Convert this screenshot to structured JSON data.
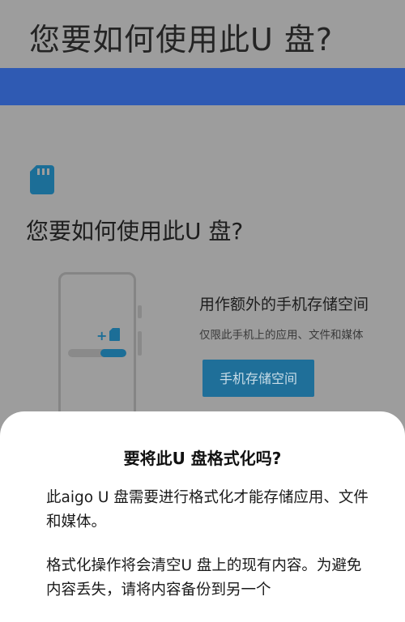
{
  "header": {
    "title": "您要如何使用此U 盘?"
  },
  "content": {
    "icon": "sd-card-icon",
    "subtitle": "您要如何使用此U 盘?",
    "option": {
      "title": "用作额外的手机存储空间",
      "description": "仅限此手机上的应用、文件和媒体",
      "button_label": "手机存储空间",
      "illustration_plus": "+",
      "illustration_fill": 0.45
    }
  },
  "dialog": {
    "title": "要将此U 盘格式化吗?",
    "paragraph1": "此aigo U 盘需要进行格式化才能存储应用、文件和媒体。",
    "paragraph2": "格式化操作将会清空U 盘上的现有内容。为避免内容丢失，请将内容备份到另一个"
  },
  "colors": {
    "accent": "#1f6f99",
    "bar": "#2f5ab3",
    "scrim": "#9d9d9d",
    "sheet": "#ffffff"
  }
}
